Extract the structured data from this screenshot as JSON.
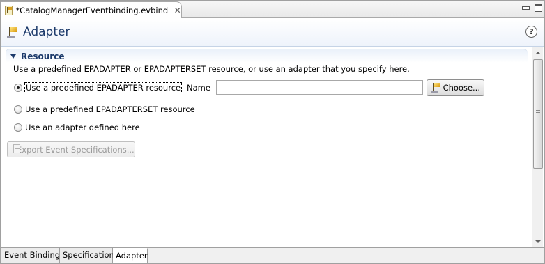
{
  "editor": {
    "tab_title": "*CatalogManagerEventbinding.evbind",
    "close_glyph": "✕"
  },
  "header": {
    "title": "Adapter",
    "help_glyph": "?"
  },
  "section": {
    "title": "Resource",
    "description": "Use a predefined EPADAPTER or EPADAPTERSET resource, or use an adapter that you specify here."
  },
  "options": [
    {
      "label": "Use a predefined EPADAPTER resource",
      "selected": true
    },
    {
      "label": "Use a predefined EPADAPTERSET resource",
      "selected": false
    },
    {
      "label": "Use an adapter defined here",
      "selected": false
    }
  ],
  "name_field": {
    "label": "Name",
    "value": ""
  },
  "buttons": {
    "choose": "Choose...",
    "export": "Export Event Specifications..."
  },
  "page_tabs": [
    {
      "label": "Event Binding",
      "active": false
    },
    {
      "label": "Specification",
      "active": false
    },
    {
      "label": "Adapter",
      "active": true
    }
  ],
  "colors": {
    "title_text": "#1c3a6b",
    "section_bar": "#eaf1fa",
    "disabled_text": "#9a9a9a"
  },
  "icons": {
    "file": "evbind-file-icon",
    "header": "adapter-flag-icon",
    "help": "help-icon",
    "choose": "adapter-flag-icon",
    "export": "export-icon"
  }
}
